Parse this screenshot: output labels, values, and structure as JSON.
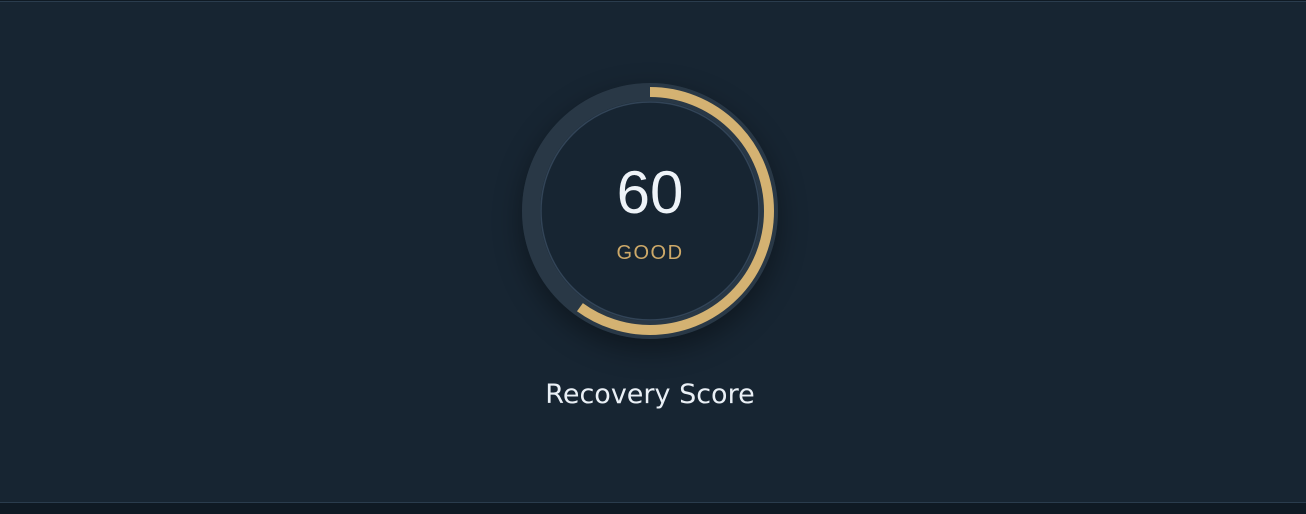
{
  "gauge": {
    "value": 60,
    "max": 100,
    "status": "GOOD",
    "label": "Recovery Score"
  },
  "colors": {
    "background": "#172532",
    "track": "#293846",
    "progress": "#d4b272",
    "value_text": "#eef3f8",
    "status_text": "#cda969",
    "label_text": "#eaf0f6"
  }
}
